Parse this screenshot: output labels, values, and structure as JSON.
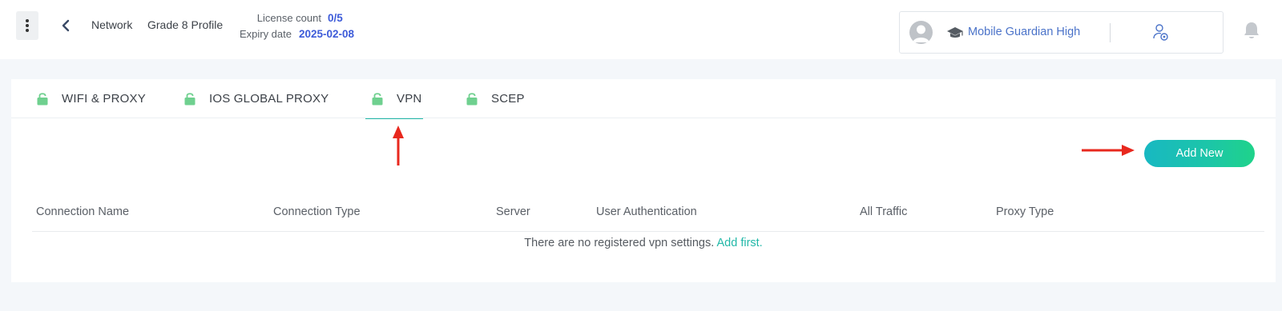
{
  "header": {
    "breadcrumb_network": "Network",
    "breadcrumb_profile": "Grade 8 Profile",
    "license_count_label": "License count",
    "license_count_value": "0/5",
    "expiry_label": "Expiry date",
    "expiry_value": "2025-02-08",
    "school_name": "Mobile Guardian High",
    "icons": [
      "menu-dots-icon",
      "chevron-left-icon",
      "user-avatar-icon",
      "graduation-cap-icon",
      "user-settings-icon",
      "bell-icon"
    ]
  },
  "tabs": [
    {
      "label": "WIFI & PROXY",
      "icon": "unlock-icon"
    },
    {
      "label": "IOS GLOBAL PROXY",
      "icon": "unlock-icon"
    },
    {
      "label": "VPN",
      "icon": "unlock-icon",
      "active": true
    },
    {
      "label": "SCEP",
      "icon": "unlock-icon"
    }
  ],
  "actions": {
    "add_new_label": "Add New"
  },
  "table": {
    "columns": [
      "Connection Name",
      "Connection Type",
      "Server",
      "User Authentication",
      "All Traffic",
      "Proxy Type"
    ],
    "empty_text": "There are no registered vpn settings.",
    "empty_link": "Add first."
  },
  "colors": {
    "accent": "#22b8a8",
    "link_blue": "#3d5bd9",
    "lock_green": "#6fd08f",
    "annotation_red": "#e8281e"
  }
}
